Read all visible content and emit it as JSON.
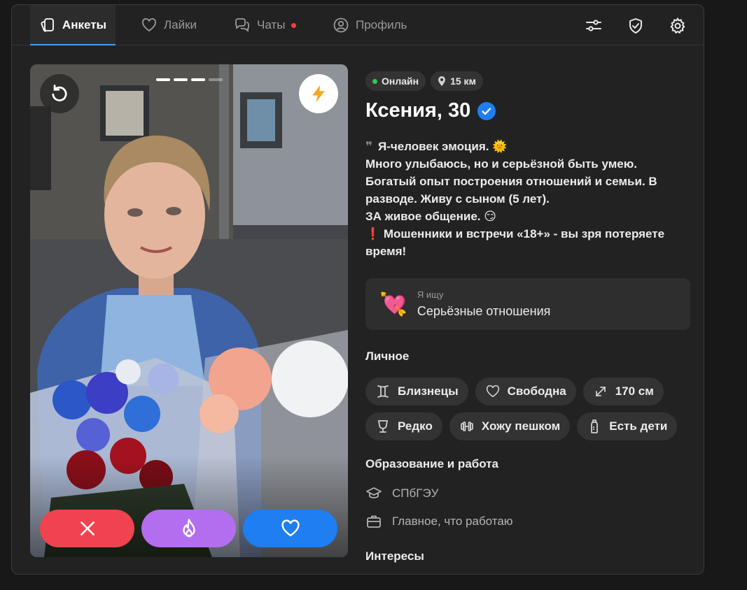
{
  "nav": {
    "tabs": [
      {
        "label": "Анкеты",
        "icon": "cards-icon",
        "active": true
      },
      {
        "label": "Лайки",
        "icon": "heart-icon",
        "active": false
      },
      {
        "label": "Чаты",
        "icon": "chat-icon",
        "active": false,
        "has_unread": true
      },
      {
        "label": "Профиль",
        "icon": "profile-icon",
        "active": false
      }
    ],
    "right_icons": [
      "filters-icon",
      "shield-check-icon",
      "settings-icon"
    ]
  },
  "photo": {
    "slides_total": 4,
    "slide_current": 3,
    "top_buttons": [
      "rewind-icon",
      "boost-bolt-icon"
    ]
  },
  "actions": [
    {
      "name": "dislike",
      "icon": "close-icon",
      "color": "#f0424f"
    },
    {
      "name": "superlike",
      "icon": "flame-icon",
      "color": "#b36ef0"
    },
    {
      "name": "like",
      "icon": "heart-icon",
      "color": "#1e7ef2"
    }
  ],
  "profile": {
    "status": "Онлайн",
    "distance": "15 км",
    "name_age": "Ксения, 30",
    "verified": true,
    "bio_lines": [
      "Я-человек эмоция. 🌞",
      "Много улыбаюсь, но и серьёзной быть умею.",
      "Богатый опыт построения отношений и семьи. В разводе. Живу с сыном (5 лет).",
      "ЗА живое общение. 😏",
      "❗ Мошенники и встречи «18+» - вы зря потеряете время!"
    ],
    "quote_glyph": "❞",
    "looking_for": {
      "label": "Я ищу",
      "value": "Серьёзные отношения",
      "emoji": "💘"
    },
    "personal": {
      "title": "Личное",
      "tags": [
        {
          "label": "Близнецы",
          "icon": "gemini-icon"
        },
        {
          "label": "Свободна",
          "icon": "heart-outline-icon"
        },
        {
          "label": "170 см",
          "icon": "height-arrows-icon"
        },
        {
          "label": "Редко",
          "icon": "wine-glass-icon"
        },
        {
          "label": "Хожу пешком",
          "icon": "dumbbell-icon"
        },
        {
          "label": "Есть дети",
          "icon": "baby-bottle-icon"
        }
      ]
    },
    "education": {
      "title": "Образование и работа",
      "items": [
        {
          "label": "СПбГЭУ",
          "icon": "graduation-cap-icon"
        },
        {
          "label": "Главное, что работаю",
          "icon": "briefcase-icon"
        }
      ]
    },
    "interests_title": "Интересы"
  },
  "colors": {
    "accent": "#4a9be8",
    "online": "#35c759",
    "unread": "#ff3b4a",
    "verified": "#1e7ef2"
  }
}
